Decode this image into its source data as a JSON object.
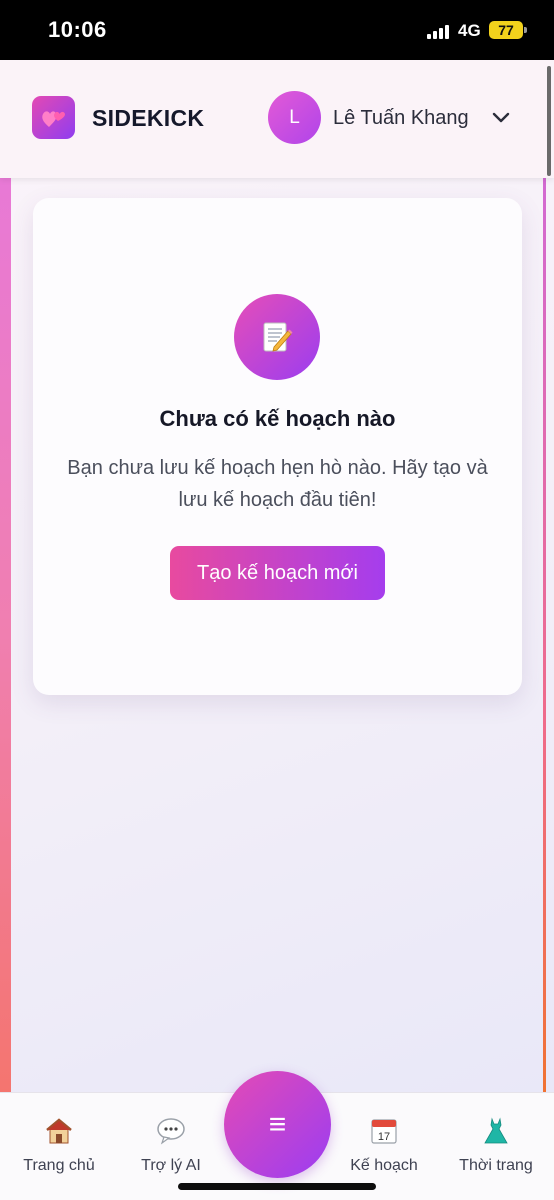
{
  "status": {
    "time": "10:06",
    "network": "4G",
    "battery": "77"
  },
  "header": {
    "brand": "SIDEKICK",
    "avatar_letter": "L",
    "username": "Lê Tuấn Khang"
  },
  "empty_state": {
    "title": "Chưa có kế hoạch nào",
    "description": "Bạn chưa lưu kế hoạch hẹn hò nào. Hãy tạo và lưu kế hoạch đầu tiên!",
    "button": "Tạo kế hoạch mới"
  },
  "bottom_nav": {
    "items": [
      {
        "label": "Trang chủ",
        "icon": "house-icon"
      },
      {
        "label": "Trợ lý AI",
        "icon": "speech-bubble-icon"
      },
      {
        "label": "Kế hoạch",
        "icon": "calendar-icon"
      },
      {
        "label": "Thời trang",
        "icon": "dress-icon"
      }
    ],
    "fab_symbol": "≡"
  },
  "colors": {
    "accent_start": "#e84a9f",
    "accent_end": "#a53ded"
  }
}
